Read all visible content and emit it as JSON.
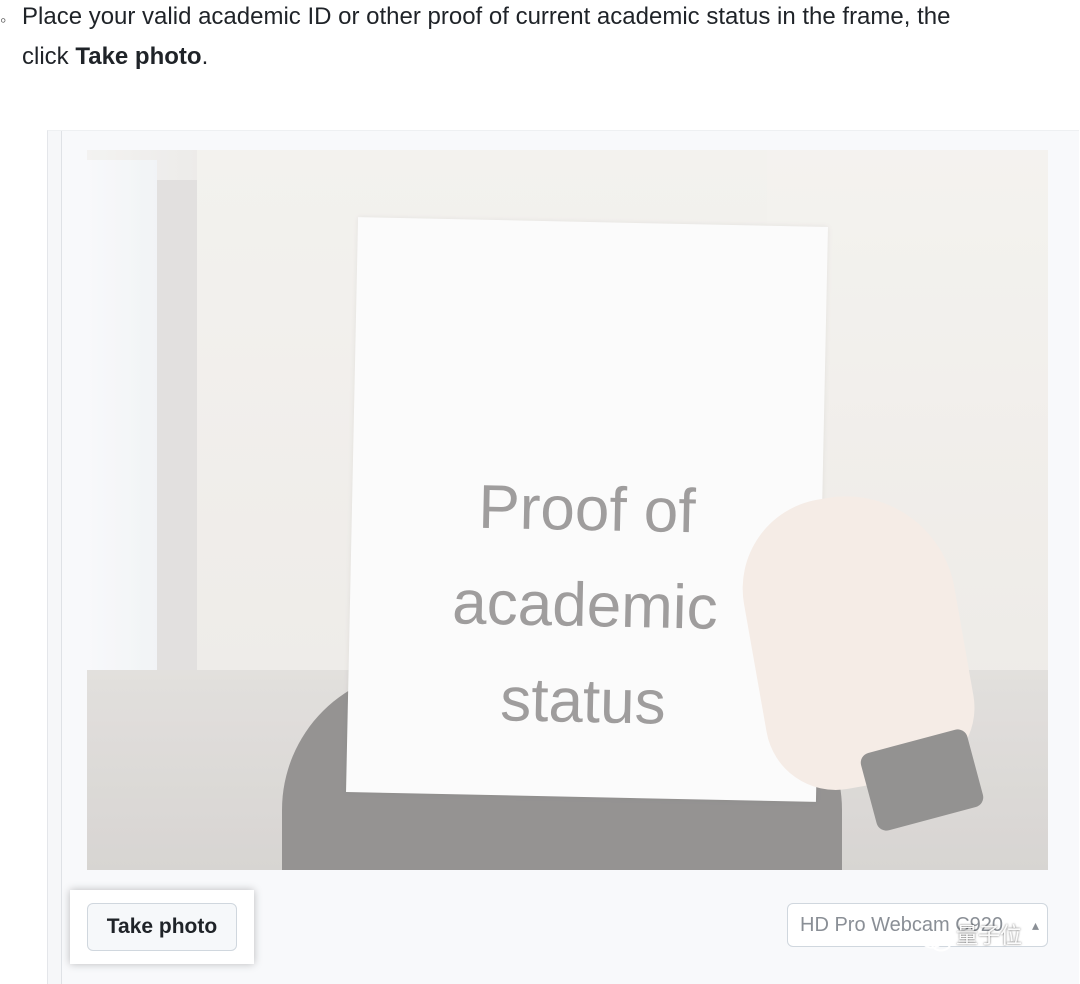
{
  "instruction": {
    "bullet": "◦",
    "line1_prefix": "Place your valid academic ID or other proof of current academic status in the frame, the",
    "line2_prefix": "click ",
    "line2_bold": "Take photo",
    "line2_suffix": "."
  },
  "camera_preview": {
    "paper_text": [
      "Proof of",
      "academic",
      "status"
    ]
  },
  "controls": {
    "take_photo_label": "Take photo",
    "camera_select_value": "HD Pro Webcam C920",
    "camera_select_icon": "updown-chevron-icon"
  },
  "watermark": {
    "text": "量子位",
    "icon": "wechat-icon"
  }
}
